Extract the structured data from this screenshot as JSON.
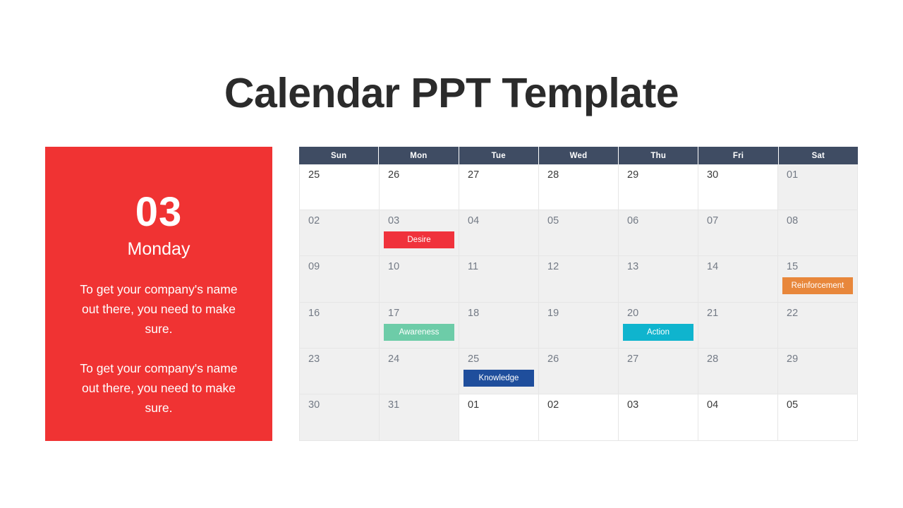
{
  "title": "Calendar PPT Template",
  "left_panel": {
    "day_number": "03",
    "day_name": "Monday",
    "paragraph_1": "To get your company's name out there, you need to make sure.",
    "paragraph_2": "To get your company's name out there, you need to make sure.",
    "background_color": "#f03333"
  },
  "calendar": {
    "header_background": "#3f4c63",
    "weekday_headers": [
      "Sun",
      "Mon",
      "Tue",
      "Wed",
      "Thu",
      "Fri",
      "Sat"
    ],
    "rows": [
      {
        "cells": [
          {
            "day": "25",
            "muted": false,
            "badge": null
          },
          {
            "day": "26",
            "muted": false,
            "badge": null
          },
          {
            "day": "27",
            "muted": false,
            "badge": null
          },
          {
            "day": "28",
            "muted": false,
            "badge": null
          },
          {
            "day": "29",
            "muted": false,
            "badge": null
          },
          {
            "day": "30",
            "muted": false,
            "badge": null
          },
          {
            "day": "01",
            "muted": true,
            "badge": null
          }
        ]
      },
      {
        "cells": [
          {
            "day": "02",
            "muted": true,
            "badge": null
          },
          {
            "day": "03",
            "muted": true,
            "badge": {
              "label": "Desire",
              "color": "#f0323c",
              "style": "red"
            }
          },
          {
            "day": "04",
            "muted": true,
            "badge": null
          },
          {
            "day": "05",
            "muted": true,
            "badge": null
          },
          {
            "day": "06",
            "muted": true,
            "badge": null
          },
          {
            "day": "07",
            "muted": true,
            "badge": null
          },
          {
            "day": "08",
            "muted": true,
            "badge": null
          }
        ]
      },
      {
        "cells": [
          {
            "day": "09",
            "muted": true,
            "badge": null
          },
          {
            "day": "10",
            "muted": true,
            "badge": null
          },
          {
            "day": "11",
            "muted": true,
            "badge": null
          },
          {
            "day": "12",
            "muted": true,
            "badge": null
          },
          {
            "day": "13",
            "muted": true,
            "badge": null
          },
          {
            "day": "14",
            "muted": true,
            "badge": null
          },
          {
            "day": "15",
            "muted": true,
            "badge": {
              "label": "Reinforcement",
              "color": "#e8873b",
              "style": "orange"
            }
          }
        ]
      },
      {
        "cells": [
          {
            "day": "16",
            "muted": true,
            "badge": null
          },
          {
            "day": "17",
            "muted": true,
            "badge": {
              "label": "Awareness",
              "color": "#6dcca8",
              "style": "green"
            }
          },
          {
            "day": "18",
            "muted": true,
            "badge": null
          },
          {
            "day": "19",
            "muted": true,
            "badge": null
          },
          {
            "day": "20",
            "muted": true,
            "badge": {
              "label": "Action",
              "color": "#0fb4ce",
              "style": "cyan"
            }
          },
          {
            "day": "21",
            "muted": true,
            "badge": null
          },
          {
            "day": "22",
            "muted": true,
            "badge": null
          }
        ]
      },
      {
        "cells": [
          {
            "day": "23",
            "muted": true,
            "badge": null
          },
          {
            "day": "24",
            "muted": true,
            "badge": null
          },
          {
            "day": "25",
            "muted": true,
            "badge": {
              "label": "Knowledge",
              "color": "#1f4e9c",
              "style": "navy"
            }
          },
          {
            "day": "26",
            "muted": true,
            "badge": null
          },
          {
            "day": "27",
            "muted": true,
            "badge": null
          },
          {
            "day": "28",
            "muted": true,
            "badge": null
          },
          {
            "day": "29",
            "muted": true,
            "badge": null
          }
        ]
      },
      {
        "cells": [
          {
            "day": "30",
            "muted": true,
            "badge": null
          },
          {
            "day": "31",
            "muted": true,
            "badge": null
          },
          {
            "day": "01",
            "muted": false,
            "badge": null
          },
          {
            "day": "02",
            "muted": false,
            "badge": null
          },
          {
            "day": "03",
            "muted": false,
            "badge": null
          },
          {
            "day": "04",
            "muted": false,
            "badge": null
          },
          {
            "day": "05",
            "muted": false,
            "badge": null
          }
        ]
      }
    ]
  }
}
